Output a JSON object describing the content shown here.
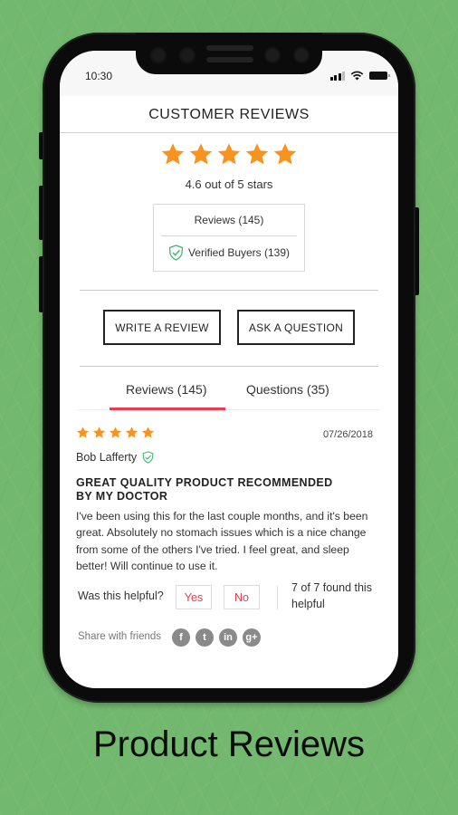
{
  "status_bar": {
    "time": "10:30",
    "icons": [
      "signal-icon",
      "wifi-icon",
      "battery-icon"
    ]
  },
  "header": {
    "title": "CUSTOMER REVIEWS"
  },
  "summary": {
    "rating": 4.6,
    "max_rating": 5,
    "stars_shown": 5,
    "rating_text": "4.6 out of 5 stars",
    "reviews_label": "Reviews (145)",
    "verified_label": "Verified Buyers (139)"
  },
  "actions": {
    "write_review": "WRITE A REVIEW",
    "ask_question": "ASK A QUESTION"
  },
  "tabs": [
    {
      "label": "Reviews (145)",
      "active": true
    },
    {
      "label": "Questions (35)",
      "active": false
    }
  ],
  "review": {
    "stars": 5,
    "date": "07/26/2018",
    "author": "Bob Lafferty",
    "verified": true,
    "title": "GREAT QUALITY PRODUCT RECOMMENDED BY MY DOCTOR",
    "body": "I've been using this for the last couple months, and it's been great. Absolutely no stomach issues which is a nice change from some of the others I've tried. I feel great, and sleep better! Will continue to use it.",
    "helpful_prompt": "Was this helpful?",
    "yes_label": "Yes",
    "no_label": "No",
    "helpful_count": "7 of 7 found this helpful",
    "share_label": "Share with friends",
    "share_icons": [
      {
        "name": "facebook-icon",
        "glyph": "f"
      },
      {
        "name": "twitter-icon",
        "glyph": "t"
      },
      {
        "name": "linkedin-icon",
        "glyph": "in"
      },
      {
        "name": "google-plus-icon",
        "glyph": "g+"
      }
    ]
  },
  "caption": "Product Reviews",
  "colors": {
    "star": "#f7931e",
    "accent": "#f03a4d",
    "verified": "#3cb878",
    "background": "#72b86e"
  }
}
